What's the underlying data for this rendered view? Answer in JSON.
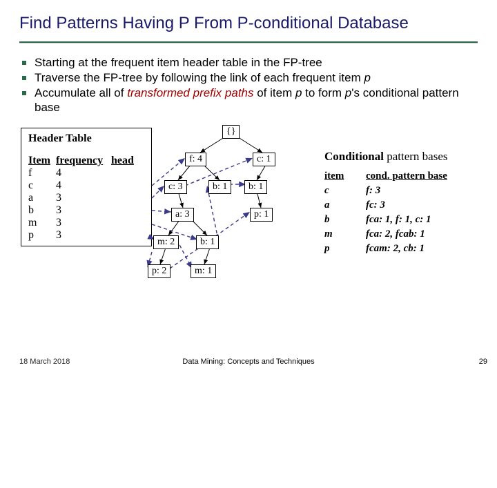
{
  "title": "Find Patterns Having P From P-conditional Database",
  "bullets": {
    "b1": "Starting at the frequent item header table in the FP-tree",
    "b2_a": "Traverse the FP-tree by following the link of each frequent item ",
    "b2_p": "p",
    "b3_a": "Accumulate all of ",
    "b3_red": "transformed prefix paths",
    "b3_b": " of item ",
    "b3_p1": "p",
    "b3_c": " to form ",
    "b3_p2": "p",
    "b3_d": "'s conditional pattern base"
  },
  "header_table": {
    "title": "Header Table",
    "cols": {
      "c1": "Item",
      "c2": "frequency",
      "c3": "head"
    },
    "rows": [
      {
        "item": "f",
        "freq": "4"
      },
      {
        "item": "c",
        "freq": "4"
      },
      {
        "item": "a",
        "freq": "3"
      },
      {
        "item": "b",
        "freq": "3"
      },
      {
        "item": "m",
        "freq": "3"
      },
      {
        "item": "p",
        "freq": "3"
      }
    ]
  },
  "tree": {
    "root": "{}",
    "f4": "f: 4",
    "c1": "c: 1",
    "c3": "c: 3",
    "b1a": "b: 1",
    "b1b": "b: 1",
    "a3": "a: 3",
    "p1": "p: 1",
    "m2": "m: 2",
    "b1c": "b: 1",
    "p2": "p: 2",
    "m1": "m: 1"
  },
  "cpb": {
    "title_bold": "Conditional",
    "title_rest": " pattern bases",
    "head1": "item",
    "head2": "cond. pattern base",
    "rows": [
      {
        "item": "c",
        "base": "f: 3"
      },
      {
        "item": "a",
        "base": "fc: 3"
      },
      {
        "item": "b",
        "base": "fca: 1, f: 1, c: 1"
      },
      {
        "item": "m",
        "base": "fca: 2, fcab: 1"
      },
      {
        "item": "p",
        "base": "fcam: 2, cb: 1"
      }
    ]
  },
  "footer": {
    "date": "18 March 2018",
    "center": "Data Mining: Concepts and Techniques",
    "page": "29"
  }
}
